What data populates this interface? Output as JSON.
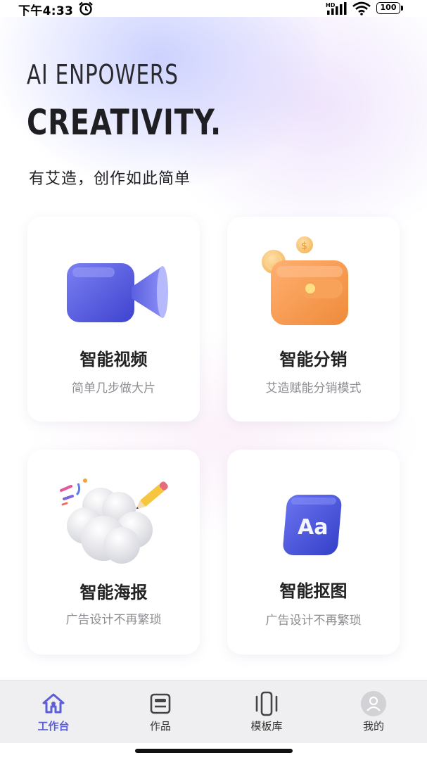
{
  "status_bar": {
    "time": "下午4:33",
    "battery": "100",
    "network_label": "HD",
    "icons": [
      "alarm-icon",
      "signal-icon",
      "wifi-icon",
      "battery-icon"
    ]
  },
  "hero": {
    "line1": "AI ENPOWERS",
    "line2": "CREATIVITY.",
    "subtitle": "有艾造，创作如此简单"
  },
  "features": [
    {
      "title": "智能视频",
      "desc": "简单几步做大片",
      "icon": "video-camera-icon"
    },
    {
      "title": "智能分销",
      "desc": "艾造赋能分销模式",
      "icon": "wallet-coins-icon"
    },
    {
      "title": "智能海报",
      "desc": "广告设计不再繁琐",
      "icon": "cloud-pencil-icon"
    },
    {
      "title": "智能抠图",
      "desc": "广告设计不再繁琐",
      "icon": "text-aa-icon"
    }
  ],
  "feature_icon_text": {
    "aa": "Aa"
  },
  "nav": {
    "active": "工作台",
    "items": [
      {
        "label": "工作台",
        "icon": "home-icon"
      },
      {
        "label": "作品",
        "icon": "works-icon"
      },
      {
        "label": "模板库",
        "icon": "template-icon"
      },
      {
        "label": "我的",
        "icon": "profile-icon"
      }
    ]
  },
  "colors": {
    "accent": "#5b5ed6",
    "video_icon": "#5a5fe0",
    "wallet_icon": "#f59a4e",
    "aa_icon": "#4350d8"
  }
}
